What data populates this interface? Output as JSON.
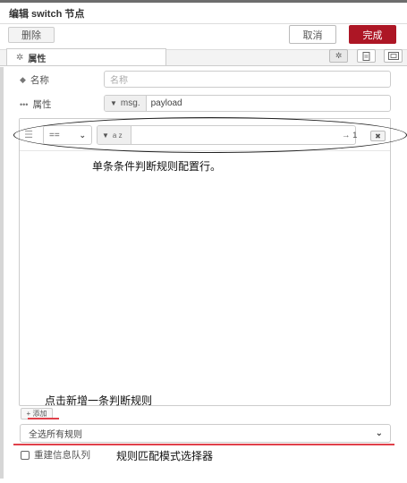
{
  "dialog": {
    "title": "编辑 switch 节点",
    "delete_label": "删除",
    "cancel_label": "取消",
    "done_label": "完成"
  },
  "tabs": {
    "properties_label": "属性",
    "icons": [
      "gear-icon",
      "description-icon",
      "appearance-icon"
    ]
  },
  "form": {
    "name_label": "名称",
    "name_placeholder": "名称",
    "property_label": "属性",
    "property_type": "msg.",
    "property_value": "payload"
  },
  "rules": [
    {
      "operator": "==",
      "value_type": "a z",
      "value": "",
      "output_label": "→ 1",
      "remove_label": "✖"
    }
  ],
  "add_button_label": "+ 添加",
  "matching_mode": "全选所有规则",
  "recreate_queue_label": "重建信息队列",
  "annotations": {
    "rule_row": "单条条件判断规则配置行。",
    "add_rule": "点击新增一条判断规则",
    "mode_selector": "规则匹配模式选择器"
  },
  "colors": {
    "primary_button": "#ad1625",
    "annotation_underline": "#e0404a"
  }
}
